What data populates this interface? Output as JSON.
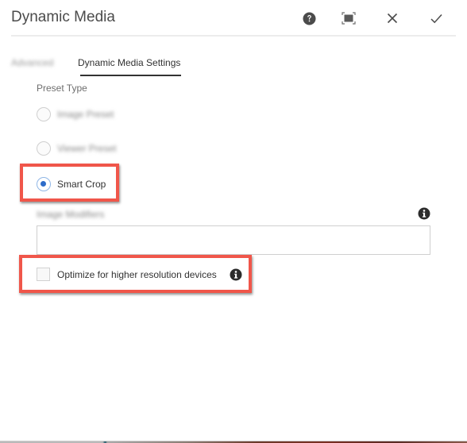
{
  "dialog": {
    "title": "Dynamic Media",
    "actions": {
      "help_icon": "help-icon",
      "fullscreen_icon": "fullscreen-icon",
      "close_icon": "close-icon",
      "confirm_icon": "checkmark-icon"
    }
  },
  "tabs": [
    {
      "label": "Advanced",
      "blurred": true,
      "active": false
    },
    {
      "label": "Dynamic Media Settings",
      "blurred": false,
      "active": true
    }
  ],
  "form": {
    "preset_type_label": "Preset Type",
    "preset_options": [
      {
        "label": "Image Preset",
        "checked": false,
        "blurred": true
      },
      {
        "label": "Viewer Preset",
        "checked": false,
        "blurred": true
      },
      {
        "label": "Smart Crop",
        "checked": true,
        "blurred": false
      }
    ],
    "image_modifiers": {
      "label": "Image Modifiers",
      "value": "",
      "info_icon": "info-icon"
    },
    "optimize_checkbox": {
      "label": "Optimize for higher resolution devices",
      "checked": false,
      "info_icon": "info-icon"
    }
  },
  "colors": {
    "highlight_border": "#f0564a",
    "radio_selected": "#2d6cc9",
    "tab_underline": "#323232"
  }
}
